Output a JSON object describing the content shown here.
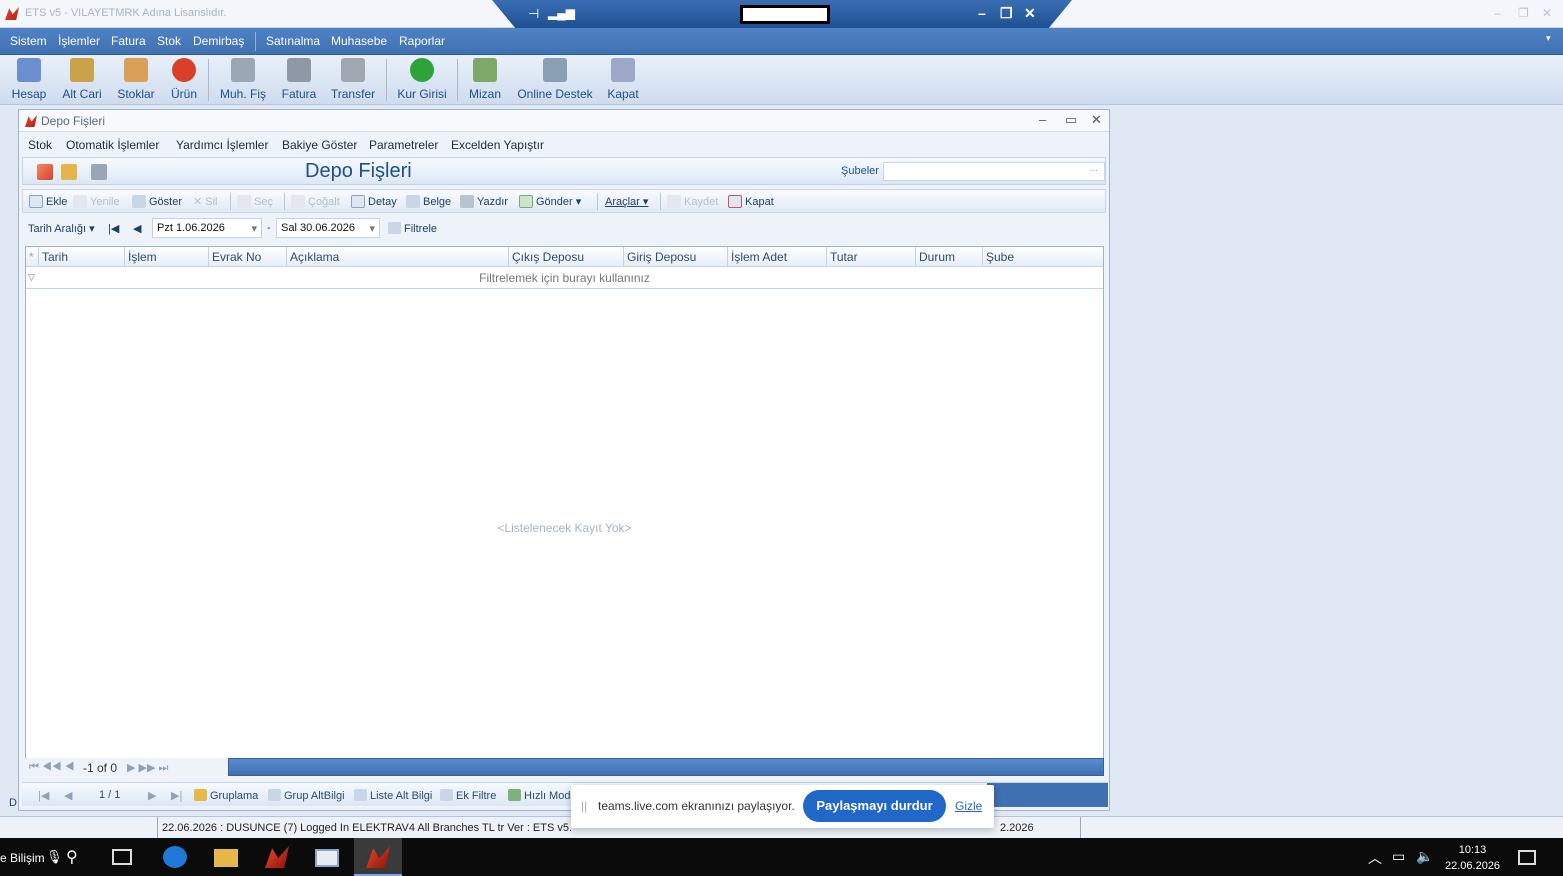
{
  "titlebar": {
    "title": "ETS v5 - VILAYETMRK Adına Lisanslıdır.",
    "minimize": "–",
    "restore": "❐",
    "close": "✕"
  },
  "remote": {
    "pin": "⊣",
    "signal": "▂▄▆",
    "min": "–",
    "restore": "❐",
    "close": "✕"
  },
  "mainmenu": [
    "Sistem",
    "İşlemler",
    "Fatura",
    "Stok",
    "Demirbaş",
    "Satınalma",
    "Muhasebe",
    "Raporlar"
  ],
  "ribbon": [
    {
      "label": "Hesap",
      "icon": "account-icon",
      "color": "#6b8fd1"
    },
    {
      "label": "Alt Cari",
      "icon": "sub-account-icon",
      "color": "#c9a24a"
    },
    {
      "label": "Stoklar",
      "icon": "stock-icon",
      "color": "#d9a05a"
    },
    {
      "label": "Ürün",
      "icon": "product-icon",
      "color": "#d9402a"
    },
    {
      "label": "Muh. Fiş",
      "icon": "voucher-icon",
      "color": "#9aa7b5"
    },
    {
      "label": "Fatura",
      "icon": "invoice-icon",
      "color": "#8e98a6"
    },
    {
      "label": "Transfer",
      "icon": "transfer-icon",
      "color": "#a0a7b0"
    },
    {
      "label": "Kur Girisi",
      "icon": "currency-icon",
      "color": "#2fa23a"
    },
    {
      "label": "Mizan",
      "icon": "balance-icon",
      "color": "#7ca86a"
    },
    {
      "label": "Online Destek",
      "icon": "support-icon",
      "color": "#8aa0b2"
    },
    {
      "label": "Kapat",
      "icon": "close-app-icon",
      "color": "#9da9c8"
    }
  ],
  "window": {
    "title": "Depo Fişleri",
    "menu": [
      "Stok",
      "Otomatik İşlemler",
      "Yardımcı İşlemler",
      "Bakiye Göster",
      "Parametreler",
      "Excelden Yapıştır"
    ],
    "page_title": "Depo Fişleri",
    "branches_label": "Şubeler",
    "branches_value": "...",
    "toolbar": {
      "ekle": "Ekle",
      "yenile": "Yenile",
      "goster": "Göster",
      "sil": "Sil",
      "sec": "Seç",
      "cogalt": "Çoğalt",
      "detay": "Detay",
      "belge": "Belge",
      "yazdir": "Yazdır",
      "gonder": "Gönder",
      "araclar": "Araçlar",
      "kaydet": "Kaydet",
      "kapat": "Kapat"
    },
    "filter": {
      "range_label": "Tarih  Aralığı",
      "start": "Pzt 1.06.2026",
      "end": "Sal 30.06.2026",
      "dash": "-",
      "apply": "Filtrele"
    },
    "grid": {
      "columns": [
        "Tarih",
        "İşlem",
        "Evrak No",
        "Açıklama",
        "Çıkış Deposu",
        "Giriş Deposu",
        "İşlem Adet",
        "Tutar",
        "Durum",
        "Şube"
      ],
      "filter_placeholder": "Filtrelemek için burayı kullanınız",
      "empty": "<Listelenecek Kayıt Yok>",
      "pager": "-1 of 0"
    },
    "bottom": {
      "page": "1 / 1",
      "gruplama": "Gruplama",
      "grup_altbilgi": "Grup AltBilgi",
      "liste_alt_bilgi": "Liste Alt Bilgi",
      "ek_filtre": "Ek Filtre",
      "hizli_mod": "Hızlı Mod"
    }
  },
  "status": {
    "text": "22.06.2026 : DUSUNCE (7) Logged In ELEKTRAV4 All Branches  TL tr Ver : ETS v5.",
    "date_right": "2.2026",
    "left_mark": "D"
  },
  "share": {
    "message": "teams.live.com ekranınızı paylaşıyor.",
    "stop": "Paylaşmayı durdur",
    "hide": "Gizle"
  },
  "taskbar": {
    "brand": "e Bilişim",
    "time": "10:13",
    "date": "22.06.2026"
  }
}
